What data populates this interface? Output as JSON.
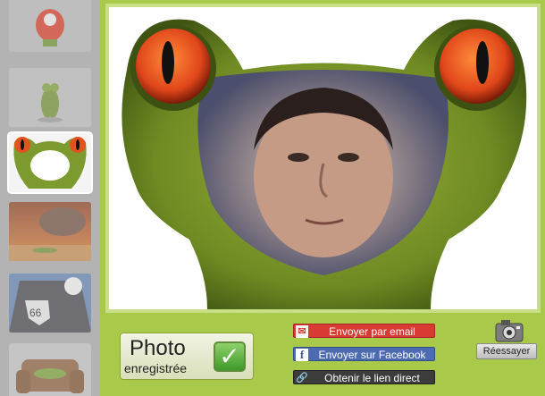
{
  "saved_badge": {
    "title": "Photo",
    "subtitle": "enregistrée",
    "check_icon": "checkmark-icon"
  },
  "actions": {
    "email": {
      "label": "Envoyer par email",
      "icon": "envelope-icon",
      "color": "#d93a33"
    },
    "facebook": {
      "label": "Envoyer sur Facebook",
      "icon": "facebook-icon",
      "color": "#4d6bb0"
    },
    "link": {
      "label": "Obtenir le lien direct",
      "icon": "link-icon",
      "color": "#3c3c3c"
    }
  },
  "retry": {
    "label": "Réessayer",
    "icon": "camera-icon"
  },
  "thumbnails": [
    {
      "name": "frog-camera"
    },
    {
      "name": "frog-standing"
    },
    {
      "name": "frog-face",
      "selected": true
    },
    {
      "name": "frog-explosion"
    },
    {
      "name": "route-66"
    },
    {
      "name": "frog-sofa"
    }
  ],
  "colors": {
    "background": "#a9c94a",
    "frame_border": "#c8df85",
    "sidebar": "#b3b3b3"
  }
}
